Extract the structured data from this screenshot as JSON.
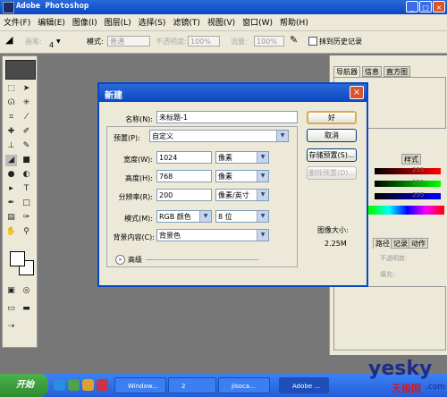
{
  "window": {
    "title": "Adobe Photoshop"
  },
  "menubar": [
    "文件(F)",
    "编辑(E)",
    "图像(I)",
    "图层(L)",
    "选择(S)",
    "滤镜(T)",
    "视图(V)",
    "窗口(W)",
    "帮助(H)"
  ],
  "options": {
    "brush_label": "画笔:",
    "brush_size": "4",
    "mode_label": "模式:",
    "mode_value": "普通",
    "opacity_label": "不透明度:",
    "opacity_value": "100%",
    "flow_label": "流量:",
    "flow_value": "100%",
    "history_label": "抹到历史记录"
  },
  "panels": {
    "top_tabs": [
      "导航器",
      "信息",
      "直方图"
    ],
    "color_tabs": [
      "",
      "",
      "样式"
    ],
    "color_values": [
      "255",
      "255",
      "255"
    ],
    "layer_tabs": [
      "路径",
      "记录",
      "动作"
    ],
    "layer_opacity_label": "不透明度:",
    "layer_fill_label": "填充:"
  },
  "dialog": {
    "title": "新建",
    "name_label": "名称(N):",
    "name_value": "未标题-1",
    "preset_label": "预置(P):",
    "preset_value": "自定义",
    "width_label": "宽度(W):",
    "width_value": "1024",
    "width_unit": "像素",
    "height_label": "高度(H):",
    "height_value": "768",
    "height_unit": "像素",
    "res_label": "分辨率(R):",
    "res_value": "200",
    "res_unit": "像素/英寸",
    "mode_label": "模式(M):",
    "mode_value": "RGB 颜色",
    "mode_bits": "8 位",
    "bg_label": "背景内容(C):",
    "bg_value": "背景色",
    "advanced_label": "高级",
    "ok": "好",
    "cancel": "取消",
    "save_preset": "存储预置(S)...",
    "delete_preset": "删除预置(D)...",
    "size_label": "图像大小:",
    "size_value": "2.25M"
  },
  "taskbar": {
    "start": "开始",
    "buttons": [
      "Window...",
      "2",
      "jisoca...",
      "Adobe ..."
    ]
  },
  "watermark": {
    "brand": "yesky",
    "sub": "天极网",
    "dotcom": ".com"
  },
  "colors": {
    "xp_blue": "#0a47c2",
    "ps_gray": "#787878",
    "panel": "#ece9d8"
  }
}
